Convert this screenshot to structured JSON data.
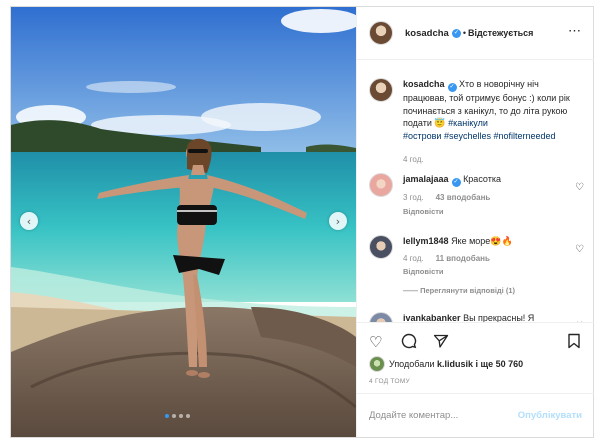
{
  "post": {
    "username": "kosadcha",
    "follow_separator": "•",
    "follow_status": "Відстежується",
    "more_icon": "⋯"
  },
  "caption": {
    "username": "kosadcha",
    "text": "Хто в новорічну ніч працював, той отримує бонус :) коли рік починається з канікул, то до літа рукою подати 😇",
    "hashtags": [
      "#канікули",
      "#острови",
      "#seychelles",
      "#nofilterneeded"
    ],
    "time": "4 год."
  },
  "comments": [
    {
      "username": "jamalajaaa",
      "verified": true,
      "text": "Красотка",
      "time": "3 год.",
      "likes": "43 вподобань",
      "reply": "Відповісти"
    },
    {
      "username": "lellym1848",
      "verified": false,
      "text": "Яке море😍🔥",
      "time": "4 год.",
      "likes": "11 вподобань",
      "reply": "Відповісти",
      "view_replies": "—— Переглянути відповіді (1)"
    },
    {
      "username": "ivankabanker",
      "verified": false,
      "text": "Вы прекрасны! Я"
    }
  ],
  "actions": {
    "like_icon": "heart-icon",
    "comment_icon": "comment-icon",
    "share_icon": "share-icon",
    "save_icon": "bookmark-icon"
  },
  "likes": {
    "prefix": "Уподобали",
    "user": "k.lidusik",
    "suffix": "і ще 50 760"
  },
  "timestamp": "4 ГОД ТОМУ",
  "add_comment": {
    "placeholder": "Додайте коментар...",
    "publish": "Опублікувати"
  },
  "carousel": {
    "prev": "‹",
    "next": "›",
    "slides": 4,
    "active": 0
  },
  "colors": {
    "accent": "#3897f0",
    "publish_disabled": "#b2dffc",
    "hashtag": "#003569",
    "meta": "#8e8e8e"
  }
}
